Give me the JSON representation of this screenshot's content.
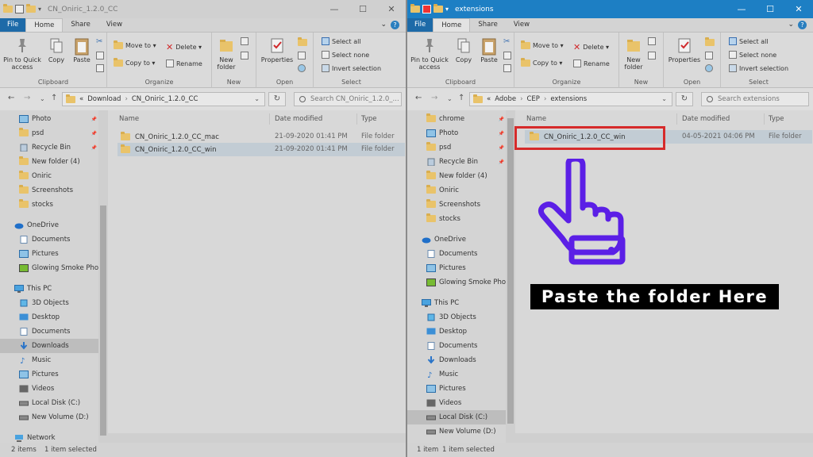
{
  "left": {
    "title": "CN_Oniric_1.2.0_CC",
    "tabs": {
      "file": "File",
      "home": "Home",
      "share": "Share",
      "view": "View"
    },
    "ribbon": {
      "pin": "Pin to Quick access",
      "copy": "Copy",
      "paste": "Paste",
      "move_to": "Move to ▾",
      "copy_to": "Copy to ▾",
      "delete": "Delete ▾",
      "rename": "Rename",
      "new_folder": "New folder",
      "properties": "Properties",
      "select_all": "Select all",
      "select_none": "Select none",
      "invert": "Invert selection",
      "groups": {
        "clipboard": "Clipboard",
        "organize": "Organize",
        "new": "New",
        "open": "Open",
        "select": "Select"
      }
    },
    "address": {
      "prefix": "«",
      "parts": [
        "Download",
        "CN_Oniric_1.2.0_CC"
      ]
    },
    "search_placeholder": "Search CN_Oniric_1.2.0_...",
    "columns": {
      "name": "Name",
      "date": "Date modified",
      "type": "Type"
    },
    "files": [
      {
        "name": "CN_Oniric_1.2.0_CC_mac",
        "date": "21-09-2020 01:41 PM",
        "type": "File folder"
      },
      {
        "name": "CN_Oniric_1.2.0_CC_win",
        "date": "21-09-2020 01:41 PM",
        "type": "File folder"
      }
    ],
    "nav": [
      "Photo",
      "psd",
      "Recycle Bin",
      "New folder (4)",
      "Oniric",
      "Screenshots",
      "stocks",
      "OneDrive",
      "Documents",
      "Pictures",
      "Glowing Smoke Phot",
      "This PC",
      "3D Objects",
      "Desktop",
      "Documents",
      "Downloads",
      "Music",
      "Pictures",
      "Videos",
      "Local Disk (C:)",
      "New Volume (D:)",
      "Network"
    ],
    "status": {
      "items": "2 items",
      "selected": "1 item selected"
    }
  },
  "right": {
    "title": "extensions",
    "tabs": {
      "file": "File",
      "home": "Home",
      "share": "Share",
      "view": "View"
    },
    "ribbon": {
      "pin": "Pin to Quick access",
      "copy": "Copy",
      "paste": "Paste",
      "move_to": "Move to ▾",
      "copy_to": "Copy to ▾",
      "delete": "Delete ▾",
      "rename": "Rename",
      "new_folder": "New folder",
      "properties": "Properties",
      "select_all": "Select all",
      "select_none": "Select none",
      "invert": "Invert selection",
      "groups": {
        "clipboard": "Clipboard",
        "organize": "Organize",
        "new": "New",
        "open": "Open",
        "select": "Select"
      }
    },
    "address": {
      "prefix": "«",
      "parts": [
        "Adobe",
        "CEP",
        "extensions"
      ]
    },
    "search_placeholder": "Search extensions",
    "columns": {
      "name": "Name",
      "date": "Date modified",
      "type": "Type"
    },
    "files": [
      {
        "name": "CN_Oniric_1.2.0_CC_win",
        "date": "04-05-2021 04:06 PM",
        "type": "File folder"
      }
    ],
    "nav": [
      "chrome",
      "Photo",
      "psd",
      "Recycle Bin",
      "New folder (4)",
      "Oniric",
      "Screenshots",
      "stocks",
      "OneDrive",
      "Documents",
      "Pictures",
      "Glowing Smoke Phot",
      "This PC",
      "3D Objects",
      "Desktop",
      "Documents",
      "Downloads",
      "Music",
      "Pictures",
      "Videos",
      "Local Disk (C:)",
      "New Volume (D:)"
    ],
    "status": {
      "items": "1 item",
      "selected": "1 item selected"
    }
  },
  "annotation": {
    "banner": "Paste the folder Here",
    "hand_color": "#5b1fe6",
    "box_color": "#d62a2a"
  },
  "colors": {
    "accent": "#1d7fc4",
    "folder": "#e9c36a"
  }
}
